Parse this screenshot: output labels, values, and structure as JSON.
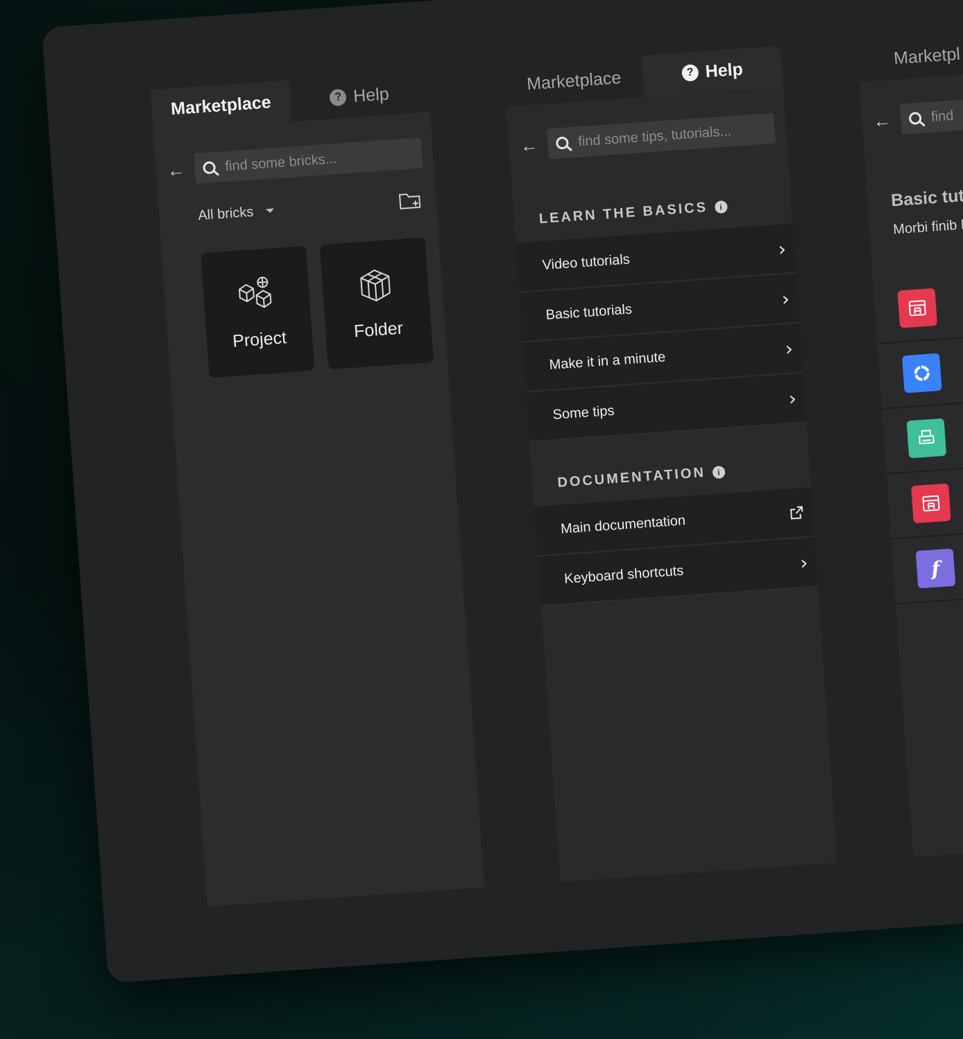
{
  "panel_marketplace": {
    "tabs": [
      {
        "label": "Marketplace"
      },
      {
        "label": "Help"
      }
    ],
    "search": {
      "placeholder": "find some bricks..."
    },
    "filter": {
      "label": "All bricks"
    },
    "cards": [
      {
        "label": "Project"
      },
      {
        "label": "Folder"
      }
    ]
  },
  "panel_help": {
    "tabs": [
      {
        "label": "Marketplace"
      },
      {
        "label": "Help"
      }
    ],
    "search": {
      "placeholder": "find some tips, tutorials..."
    },
    "learn": {
      "title": "LEARN THE BASICS",
      "items": [
        {
          "label": "Video tutorials"
        },
        {
          "label": "Basic tutorials"
        },
        {
          "label": "Make it in a minute"
        },
        {
          "label": "Some tips"
        }
      ]
    },
    "documentation": {
      "title": "DOCUMENTATION",
      "items": [
        {
          "label": "Main documentation"
        },
        {
          "label": "Keyboard shortcuts"
        }
      ]
    }
  },
  "panel_basic": {
    "tabs": [
      {
        "label": "Marketpl"
      }
    ],
    "search": {
      "placeholder": "find"
    },
    "title": "Basic tut",
    "description": "Morbi finib Nullam di euismod",
    "tiles": [
      {
        "icon": "table-icon",
        "color": "#e53950"
      },
      {
        "icon": "ring-icon",
        "color": "#3b82f6"
      },
      {
        "icon": "printer-icon",
        "color": "#3fbf9a"
      },
      {
        "icon": "table-icon",
        "color": "#e53950"
      },
      {
        "icon": "function-icon",
        "color": "#7b6fe0",
        "glyph": "f"
      }
    ]
  },
  "colors": {
    "board": "#222325",
    "panel": "#2c2c2e",
    "list_row": "#202022",
    "card": "#1b1b1d",
    "text": "#efefef"
  }
}
